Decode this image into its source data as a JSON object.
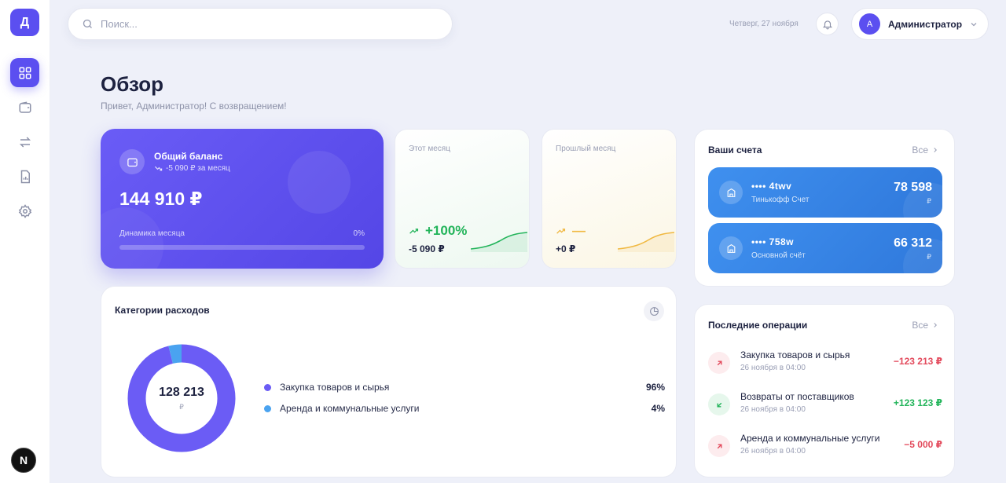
{
  "sidebar": {
    "logo": "Д",
    "bottom_badge": "N",
    "items": [
      {
        "name": "dashboard",
        "icon": "grid-icon",
        "active": true
      },
      {
        "name": "wallet",
        "icon": "wallet-icon",
        "active": false
      },
      {
        "name": "transfers",
        "icon": "arrows-icon",
        "active": false
      },
      {
        "name": "reports",
        "icon": "report-icon",
        "active": false
      },
      {
        "name": "settings",
        "icon": "gear-icon",
        "active": false
      }
    ]
  },
  "header": {
    "search_placeholder": "Поиск...",
    "date": "Четверг, 27 ноября",
    "user_initial": "А",
    "user_name": "Администратор"
  },
  "page": {
    "title": "Обзор",
    "subtitle": "Привет, Администратор! С возвращением!"
  },
  "balance": {
    "label": "Общий баланс",
    "change": "-5 090 ₽ за месяц",
    "amount": "144 910 ₽",
    "dynamics_label": "Динамика месяца",
    "dynamics_pct": "0%",
    "dynamics_fraction": 0
  },
  "this_month": {
    "label": "Этот месяц",
    "trend": "+100%",
    "value": "-5 090 ₽",
    "color": "#22b45a"
  },
  "last_month": {
    "label": "Прошлый месяц",
    "trend": "—",
    "value": "+0 ₽",
    "color": "#f0b840"
  },
  "accounts": {
    "title": "Ваши счета",
    "all_label": "Все",
    "items": [
      {
        "number": "•••• 4twv",
        "name": "Тинькофф Счет",
        "amount": "78 598",
        "currency": "₽"
      },
      {
        "number": "•••• 758w",
        "name": "Основной счёт",
        "amount": "66 312",
        "currency": "₽"
      }
    ]
  },
  "categories": {
    "title": "Категории расходов",
    "total": "128 213",
    "currency": "₽",
    "items": [
      {
        "label": "Закупка товаров и сырья",
        "pct": "96%",
        "color": "#6b5cf5"
      },
      {
        "label": "Аренда и коммунальные услуги",
        "pct": "4%",
        "color": "#4aa3f0"
      }
    ]
  },
  "operations": {
    "title": "Последние операции",
    "all_label": "Все",
    "items": [
      {
        "name": "Закупка товаров и сырья",
        "date": "26 ноября в 04:00",
        "amount": "−123 213 ₽",
        "type": "out"
      },
      {
        "name": "Возвраты от поставщиков",
        "date": "26 ноября в 04:00",
        "amount": "+123 123 ₽",
        "type": "in"
      },
      {
        "name": "Аренда и коммунальные услуги",
        "date": "26 ноября в 04:00",
        "amount": "−5 000 ₽",
        "type": "out"
      }
    ]
  }
}
